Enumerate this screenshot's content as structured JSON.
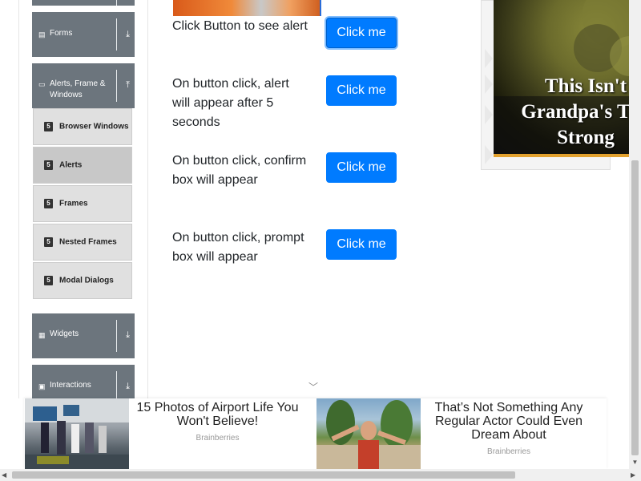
{
  "sidebar": {
    "groups": [
      {
        "label": "Forms",
        "icon": "list-icon"
      },
      {
        "label": "Alerts, Frame & Windows",
        "icon": "window-icon"
      },
      {
        "label": "Widgets",
        "icon": "grid-icon"
      },
      {
        "label": "Interactions",
        "icon": "square-icon"
      }
    ],
    "items": [
      {
        "label": "Browser Windows"
      },
      {
        "label": "Alerts"
      },
      {
        "label": "Frames"
      },
      {
        "label": "Nested Frames"
      },
      {
        "label": "Modal Dialogs"
      }
    ],
    "active_item": "Alerts"
  },
  "rows": [
    {
      "text": "Click Button to see alert",
      "button": "Click me"
    },
    {
      "text": "On button click, alert will appear after 5 seconds",
      "button": "Click me"
    },
    {
      "text": "On button click, confirm box will appear",
      "button": "Click me"
    },
    {
      "text": "On button click, prompt box will appear",
      "button": "Click me"
    }
  ],
  "side_ad": {
    "headline": "This Isn't\nGrandpa's The\nStrong"
  },
  "bottom_ads": [
    {
      "title": "15 Photos of Airport Life You Won't Believe!",
      "source": "Brainberries"
    },
    {
      "title": "That’s Not Something Any Regular Actor Could Even Dream About",
      "source": "Brainberries"
    }
  ],
  "colors": {
    "primary_button": "#007bff",
    "group_header": "#6c757d",
    "sub_item": "#e0e0e0"
  }
}
